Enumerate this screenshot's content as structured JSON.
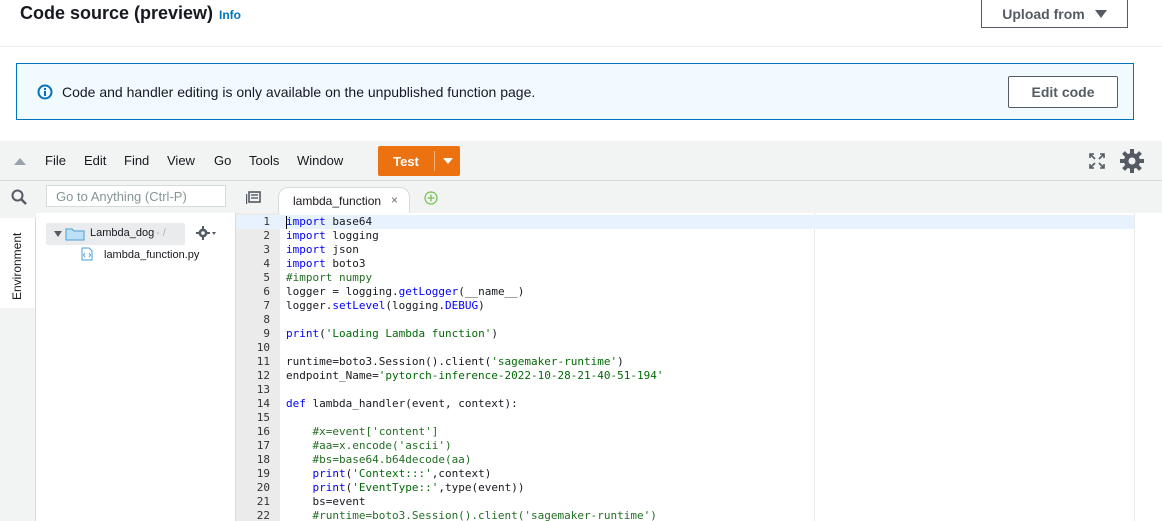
{
  "header": {
    "title": "Code source (preview)",
    "info_link": "Info",
    "upload_label": "Upload from"
  },
  "alert": {
    "icon": "info-circle-icon",
    "message": "Code and handler editing is only available on the unpublished function page.",
    "edit_button": "Edit code"
  },
  "menu": {
    "items": [
      "File",
      "Edit",
      "Find",
      "View",
      "Go",
      "Tools",
      "Window"
    ],
    "test_label": "Test"
  },
  "search": {
    "placeholder": "Go to Anything (Ctrl-P)"
  },
  "sidebar": {
    "environment_label": "Environment"
  },
  "tree": {
    "folder_name": "Lambda_dog",
    "folder_path": "- /",
    "file_name": "lambda_function.py"
  },
  "editor": {
    "tab_label": "lambda_function",
    "tab_close": "×",
    "lines": [
      {
        "n": "1",
        "t": "import base64"
      },
      {
        "n": "2",
        "t": "import logging"
      },
      {
        "n": "3",
        "t": "import json"
      },
      {
        "n": "4",
        "t": "import boto3"
      },
      {
        "n": "5",
        "t": "#import numpy"
      },
      {
        "n": "6",
        "t": "logger = logging.getLogger(__name__)"
      },
      {
        "n": "7",
        "t": "logger.setLevel(logging.DEBUG)"
      },
      {
        "n": "8",
        "t": ""
      },
      {
        "n": "9",
        "t": "print('Loading Lambda function')"
      },
      {
        "n": "10",
        "t": ""
      },
      {
        "n": "11",
        "t": "runtime=boto3.Session().client('sagemaker-runtime')"
      },
      {
        "n": "12",
        "t": "endpoint_Name='pytorch-inference-2022-10-28-21-40-51-194'"
      },
      {
        "n": "13",
        "t": ""
      },
      {
        "n": "14",
        "t": "def lambda_handler(event, context):"
      },
      {
        "n": "15",
        "t": ""
      },
      {
        "n": "16",
        "t": "    #x=event['content']"
      },
      {
        "n": "17",
        "t": "    #aa=x.encode('ascii')"
      },
      {
        "n": "18",
        "t": "    #bs=base64.b64decode(aa)"
      },
      {
        "n": "19",
        "t": "    print('Context:::',context)"
      },
      {
        "n": "20",
        "t": "    print('EventType::',type(event))"
      },
      {
        "n": "21",
        "t": "    bs=event"
      },
      {
        "n": "22",
        "t": "    #runtime=boto3.Session().client('sagemaker-runtime')"
      }
    ]
  },
  "colors": {
    "accent_orange": "#ec7211",
    "link_blue": "#0073bb",
    "alert_bg": "#f1faff"
  }
}
